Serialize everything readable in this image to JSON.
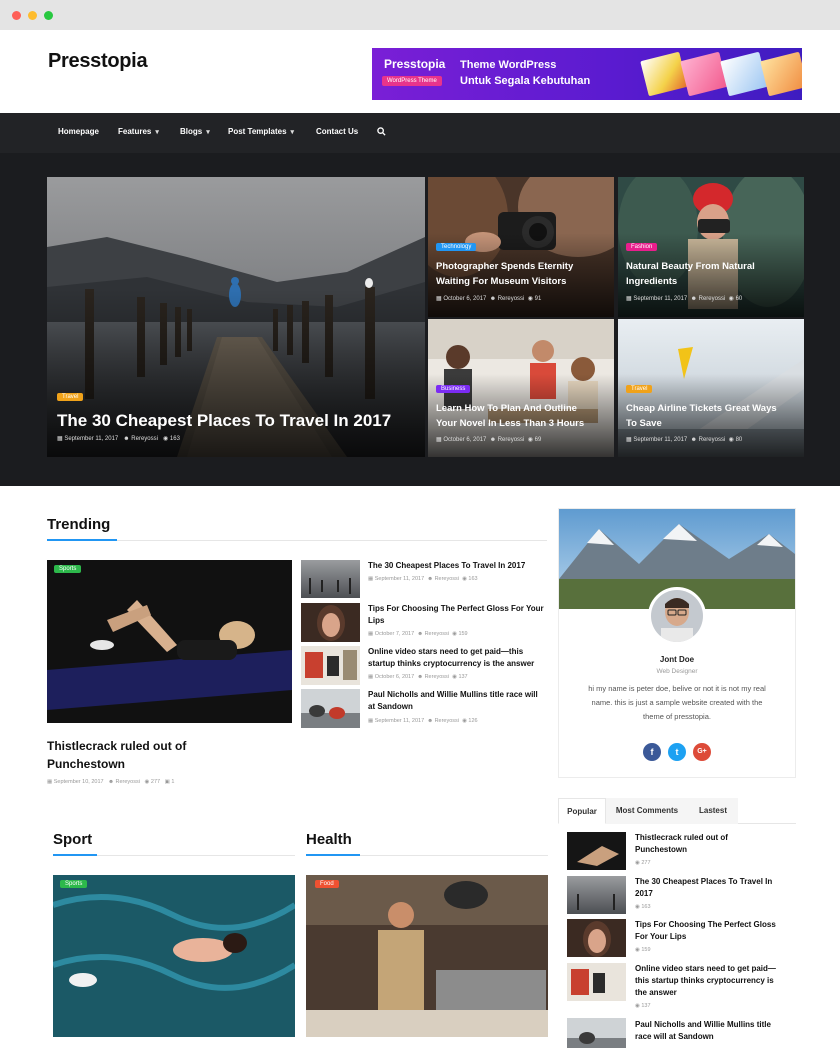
{
  "site": {
    "logo": "Presstopia",
    "banner": {
      "logo": "Presstopia",
      "tag": "WordPress Theme",
      "line1": "Theme WordPress",
      "line2": "Untuk Segala Kebutuhan"
    }
  },
  "nav": {
    "items": [
      {
        "label": "Homepage"
      },
      {
        "label": "Features"
      },
      {
        "label": "Blogs"
      },
      {
        "label": "Post Templates"
      },
      {
        "label": "Contact Us"
      }
    ],
    "search_icon": "search-icon"
  },
  "hero": {
    "main": {
      "category": "Travel",
      "title": "The 30 Cheapest Places To Travel In 2017",
      "date": "September 11, 2017",
      "author": "Rereyossi",
      "views": "163"
    },
    "tiles": [
      {
        "category": "Technology",
        "title_1": "Photographer Spends Eternity",
        "title_2": "Waiting For Museum Visitors",
        "date": "October 6, 2017",
        "author": "Rereyossi",
        "views": "91"
      },
      {
        "category": "Fashion",
        "title_1": "Natural Beauty From Natural",
        "title_2": "Ingredients",
        "date": "September 11, 2017",
        "author": "Rereyossi",
        "views": "60"
      },
      {
        "category": "Business",
        "title_1": "Learn How To Plan And Outline",
        "title_2": "Your Novel In Less Than 3 Hours",
        "date": "October 6, 2017",
        "author": "Rereyossi",
        "views": "69"
      },
      {
        "category": "Travel",
        "title_1": "Cheap Airline Tickets Great Ways",
        "title_2": "To Save",
        "date": "September 11, 2017",
        "author": "Rereyossi",
        "views": "80"
      }
    ]
  },
  "trending": {
    "heading": "Trending",
    "feature": {
      "category": "Sports",
      "title_1": "Thistlecrack ruled out of",
      "title_2": "Punchestown",
      "date": "September 10, 2017",
      "author": "Rereyossi",
      "views": "277",
      "comments": "1"
    },
    "list": [
      {
        "title_1": "The 30 Cheapest Places To Travel In 2017",
        "title_2": "",
        "date": "September 11, 2017",
        "author": "Rereyossi",
        "views": "163"
      },
      {
        "title_1": "Tips For Choosing The Perfect Gloss For Your",
        "title_2": "Lips",
        "date": "October 7, 2017",
        "author": "Rereyossi",
        "views": "159"
      },
      {
        "title_1": "Online video stars need to get paid—this",
        "title_2": "startup thinks cryptocurrency is the answer",
        "date": "October 6, 2017",
        "author": "Rereyossi",
        "views": "137"
      },
      {
        "title_1": "Paul Nicholls and Willie Mullins title race will",
        "title_2": "at Sandown",
        "date": "September 11, 2017",
        "author": "Rereyossi",
        "views": "126"
      }
    ]
  },
  "sport": {
    "heading": "Sport",
    "category": "Sports"
  },
  "health": {
    "heading": "Health",
    "category": "Food"
  },
  "author": {
    "name": "Jont Doe",
    "role": "Web Designer",
    "bio_1": "hi my name is peter doe, belive or not it is not my real",
    "bio_2": "name. this is just a sample website created with the",
    "bio_3": "theme of presstopia.",
    "social": [
      "f",
      "t",
      "G+"
    ]
  },
  "tabs": {
    "labels": [
      "Popular",
      "Most Comments",
      "Lastest"
    ],
    "items": [
      {
        "title_1": "Thistlecrack ruled out of",
        "title_2": "Punchestown",
        "views": "277"
      },
      {
        "title_1": "The 30 Cheapest Places To Travel In",
        "title_2": "2017",
        "views": "163"
      },
      {
        "title_1": "Tips For Choosing The Perfect Gloss",
        "title_2": "For Your Lips",
        "views": "159"
      },
      {
        "title_1": "Online video stars need to get paid—",
        "title_2": "this startup thinks cryptocurrency is",
        "title_3": "the answer",
        "views": "137"
      },
      {
        "title_1": "Paul Nicholls and Willie Mullins title",
        "title_2": "race will at Sandown",
        "views": ""
      }
    ]
  },
  "colors": {
    "accent": "#2196f3",
    "travel": "#f0a21a",
    "technology": "#2196f3",
    "fashion": "#e91e8c",
    "business": "#7b2bf3",
    "sports": "#2db84b",
    "food": "#ef5131"
  }
}
